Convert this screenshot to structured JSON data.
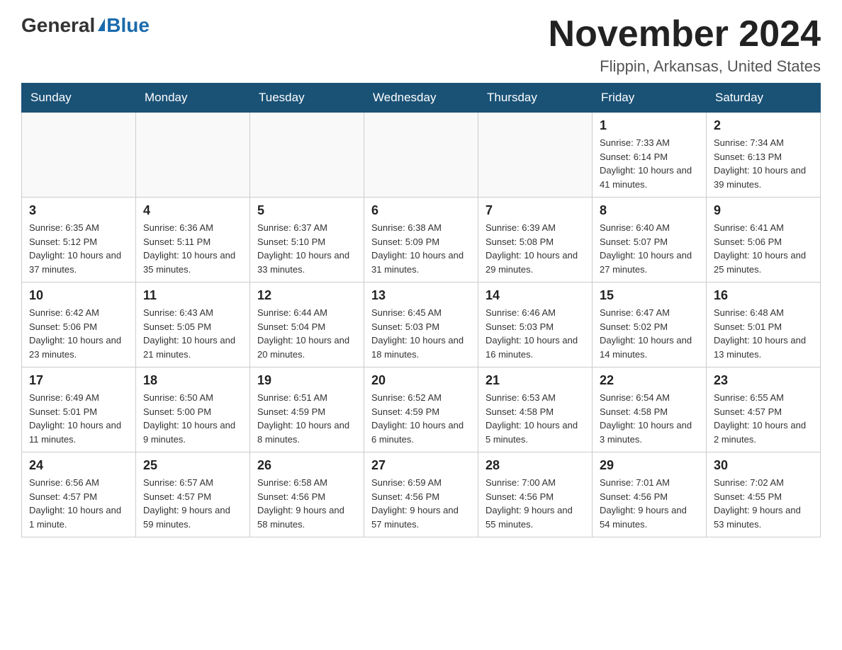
{
  "header": {
    "logo_general": "General",
    "logo_blue": "Blue",
    "month_title": "November 2024",
    "location": "Flippin, Arkansas, United States"
  },
  "weekdays": [
    "Sunday",
    "Monday",
    "Tuesday",
    "Wednesday",
    "Thursday",
    "Friday",
    "Saturday"
  ],
  "weeks": [
    [
      {
        "day": "",
        "info": ""
      },
      {
        "day": "",
        "info": ""
      },
      {
        "day": "",
        "info": ""
      },
      {
        "day": "",
        "info": ""
      },
      {
        "day": "",
        "info": ""
      },
      {
        "day": "1",
        "info": "Sunrise: 7:33 AM\nSunset: 6:14 PM\nDaylight: 10 hours and 41 minutes."
      },
      {
        "day": "2",
        "info": "Sunrise: 7:34 AM\nSunset: 6:13 PM\nDaylight: 10 hours and 39 minutes."
      }
    ],
    [
      {
        "day": "3",
        "info": "Sunrise: 6:35 AM\nSunset: 5:12 PM\nDaylight: 10 hours and 37 minutes."
      },
      {
        "day": "4",
        "info": "Sunrise: 6:36 AM\nSunset: 5:11 PM\nDaylight: 10 hours and 35 minutes."
      },
      {
        "day": "5",
        "info": "Sunrise: 6:37 AM\nSunset: 5:10 PM\nDaylight: 10 hours and 33 minutes."
      },
      {
        "day": "6",
        "info": "Sunrise: 6:38 AM\nSunset: 5:09 PM\nDaylight: 10 hours and 31 minutes."
      },
      {
        "day": "7",
        "info": "Sunrise: 6:39 AM\nSunset: 5:08 PM\nDaylight: 10 hours and 29 minutes."
      },
      {
        "day": "8",
        "info": "Sunrise: 6:40 AM\nSunset: 5:07 PM\nDaylight: 10 hours and 27 minutes."
      },
      {
        "day": "9",
        "info": "Sunrise: 6:41 AM\nSunset: 5:06 PM\nDaylight: 10 hours and 25 minutes."
      }
    ],
    [
      {
        "day": "10",
        "info": "Sunrise: 6:42 AM\nSunset: 5:06 PM\nDaylight: 10 hours and 23 minutes."
      },
      {
        "day": "11",
        "info": "Sunrise: 6:43 AM\nSunset: 5:05 PM\nDaylight: 10 hours and 21 minutes."
      },
      {
        "day": "12",
        "info": "Sunrise: 6:44 AM\nSunset: 5:04 PM\nDaylight: 10 hours and 20 minutes."
      },
      {
        "day": "13",
        "info": "Sunrise: 6:45 AM\nSunset: 5:03 PM\nDaylight: 10 hours and 18 minutes."
      },
      {
        "day": "14",
        "info": "Sunrise: 6:46 AM\nSunset: 5:03 PM\nDaylight: 10 hours and 16 minutes."
      },
      {
        "day": "15",
        "info": "Sunrise: 6:47 AM\nSunset: 5:02 PM\nDaylight: 10 hours and 14 minutes."
      },
      {
        "day": "16",
        "info": "Sunrise: 6:48 AM\nSunset: 5:01 PM\nDaylight: 10 hours and 13 minutes."
      }
    ],
    [
      {
        "day": "17",
        "info": "Sunrise: 6:49 AM\nSunset: 5:01 PM\nDaylight: 10 hours and 11 minutes."
      },
      {
        "day": "18",
        "info": "Sunrise: 6:50 AM\nSunset: 5:00 PM\nDaylight: 10 hours and 9 minutes."
      },
      {
        "day": "19",
        "info": "Sunrise: 6:51 AM\nSunset: 4:59 PM\nDaylight: 10 hours and 8 minutes."
      },
      {
        "day": "20",
        "info": "Sunrise: 6:52 AM\nSunset: 4:59 PM\nDaylight: 10 hours and 6 minutes."
      },
      {
        "day": "21",
        "info": "Sunrise: 6:53 AM\nSunset: 4:58 PM\nDaylight: 10 hours and 5 minutes."
      },
      {
        "day": "22",
        "info": "Sunrise: 6:54 AM\nSunset: 4:58 PM\nDaylight: 10 hours and 3 minutes."
      },
      {
        "day": "23",
        "info": "Sunrise: 6:55 AM\nSunset: 4:57 PM\nDaylight: 10 hours and 2 minutes."
      }
    ],
    [
      {
        "day": "24",
        "info": "Sunrise: 6:56 AM\nSunset: 4:57 PM\nDaylight: 10 hours and 1 minute."
      },
      {
        "day": "25",
        "info": "Sunrise: 6:57 AM\nSunset: 4:57 PM\nDaylight: 9 hours and 59 minutes."
      },
      {
        "day": "26",
        "info": "Sunrise: 6:58 AM\nSunset: 4:56 PM\nDaylight: 9 hours and 58 minutes."
      },
      {
        "day": "27",
        "info": "Sunrise: 6:59 AM\nSunset: 4:56 PM\nDaylight: 9 hours and 57 minutes."
      },
      {
        "day": "28",
        "info": "Sunrise: 7:00 AM\nSunset: 4:56 PM\nDaylight: 9 hours and 55 minutes."
      },
      {
        "day": "29",
        "info": "Sunrise: 7:01 AM\nSunset: 4:56 PM\nDaylight: 9 hours and 54 minutes."
      },
      {
        "day": "30",
        "info": "Sunrise: 7:02 AM\nSunset: 4:55 PM\nDaylight: 9 hours and 53 minutes."
      }
    ]
  ]
}
